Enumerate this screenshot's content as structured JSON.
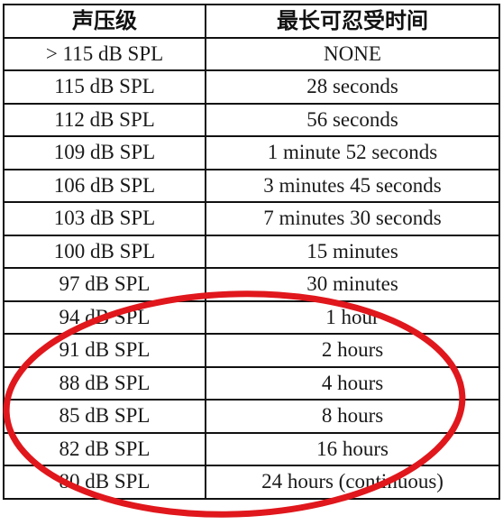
{
  "table": {
    "headers": {
      "level": "声压级",
      "max_time": "最长可忍受时间"
    },
    "rows": [
      {
        "level": "> 115 dB SPL",
        "max_time": "NONE"
      },
      {
        "level": "115 dB SPL",
        "max_time": "28 seconds"
      },
      {
        "level": "112 dB SPL",
        "max_time": "56 seconds"
      },
      {
        "level": "109 dB SPL",
        "max_time": "1 minute 52 seconds"
      },
      {
        "level": "106 dB SPL",
        "max_time": "3 minutes 45 seconds"
      },
      {
        "level": "103 dB SPL",
        "max_time": "7 minutes 30 seconds"
      },
      {
        "level": "100 dB SPL",
        "max_time": "15 minutes"
      },
      {
        "level": "97 dB SPL",
        "max_time": "30 minutes"
      },
      {
        "level": "94 dB SPL",
        "max_time": "1 hour"
      },
      {
        "level": "91 dB SPL",
        "max_time": "2 hours"
      },
      {
        "level": "88 dB SPL",
        "max_time": "4 hours"
      },
      {
        "level": "85 dB SPL",
        "max_time": "8 hours"
      },
      {
        "level": "82 dB SPL",
        "max_time": "16 hours"
      },
      {
        "level": "80 dB SPL",
        "max_time": "24 hours (continuous)"
      }
    ]
  },
  "annotation": {
    "type": "ellipse-highlight",
    "color": "#e0171c",
    "covers_rows": [
      "94 dB SPL",
      "91 dB SPL",
      "88 dB SPL",
      "85 dB SPL",
      "82 dB SPL",
      "80 dB SPL"
    ]
  }
}
